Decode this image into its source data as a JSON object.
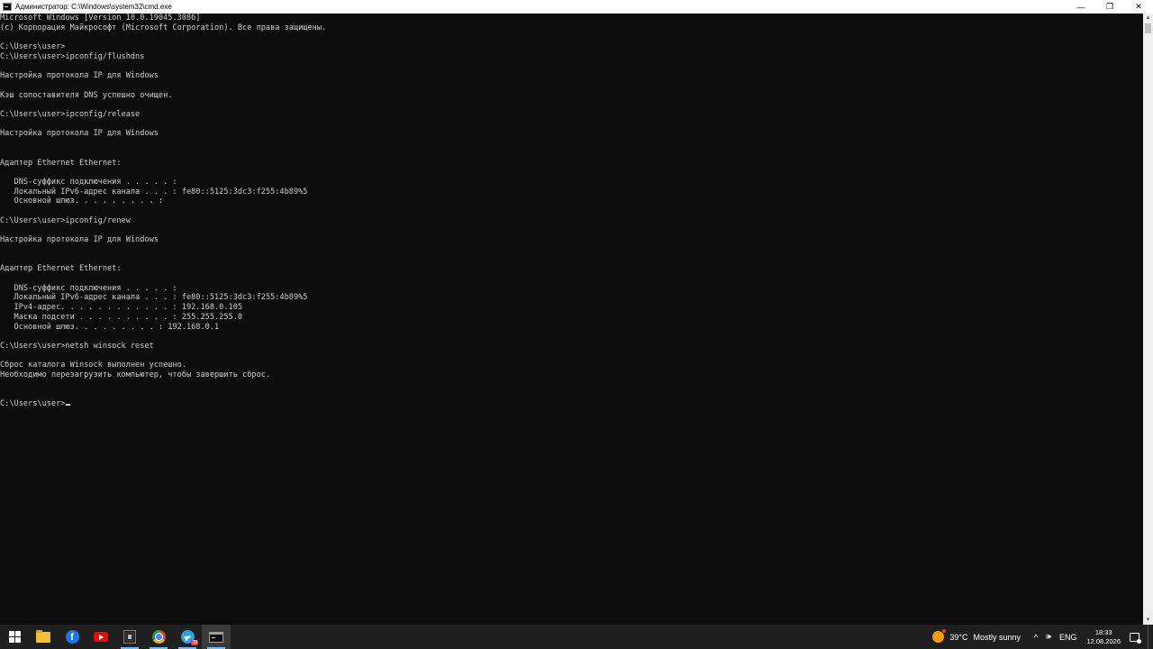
{
  "window": {
    "title": "Администратор: C:\\Windows\\system32\\cmd.exe",
    "controls": {
      "minimize": "—",
      "maximize": "❐",
      "close": "✕"
    }
  },
  "console": {
    "lines": [
      "Microsoft Windows [Version 10.0.19045.3086]",
      "(c) Корпорация Майкрософт (Microsoft Corporation). Все права защищены.",
      "",
      "C:\\Users\\user>",
      "C:\\Users\\user>ipconfig/flushdns",
      "",
      "Настройка протокола IP для Windows",
      "",
      "Кэш сопоставителя DNS успешно очищен.",
      "",
      "C:\\Users\\user>ipconfig/release",
      "",
      "Настройка протокола IP для Windows",
      "",
      "",
      "Адаптер Ethernet Ethernet:",
      "",
      "   DNS-суффикс подключения . . . . . :",
      "   Локальный IPv6-адрес канала . . . : fe80::5125:3dc3:f255:4b89%5",
      "   Основной шлюз. . . . . . . . . :",
      "",
      "C:\\Users\\user>ipconfig/renew",
      "",
      "Настройка протокола IP для Windows",
      "",
      "",
      "Адаптер Ethernet Ethernet:",
      "",
      "   DNS-суффикс подключения . . . . . :",
      "   Локальный IPv6-адрес канала . . . : fe80::5125:3dc3:f255:4b89%5",
      "   IPv4-адрес. . . . . . . . . . . . : 192.168.0.105",
      "   Маска подсети . . . . . . . . . . : 255.255.255.0",
      "   Основной шлюз. . . . . . . . . : 192.168.0.1",
      "",
      "C:\\Users\\user>netsh winsock reset",
      "",
      "Сброс каталога Winsock выполнен успешно.",
      "Необходимо перезагрузить компьютер, чтобы завершить сброс.",
      "",
      ""
    ],
    "prompt": "C:\\Users\\user>"
  },
  "taskbar": {
    "apps": [
      {
        "name": "start",
        "icon": "windows-logo-icon"
      },
      {
        "name": "file-explorer",
        "icon": "folder-icon"
      },
      {
        "name": "facebook",
        "icon": "facebook-icon"
      },
      {
        "name": "youtube",
        "icon": "youtube-icon"
      },
      {
        "name": "app",
        "icon": "dark-app-icon"
      },
      {
        "name": "chrome",
        "icon": "chrome-icon"
      },
      {
        "name": "telegram",
        "icon": "telegram-icon",
        "badge": "38"
      },
      {
        "name": "cmd",
        "icon": "cmd-icon",
        "active": true
      }
    ],
    "facebook_glyph": "f",
    "tray": {
      "weather_temp": "39°C",
      "weather_desc": "Mostly sunny",
      "chevron": "^",
      "volume": "🕪",
      "language": "ENG",
      "time": "18:33",
      "date": "12.08.2026"
    }
  }
}
